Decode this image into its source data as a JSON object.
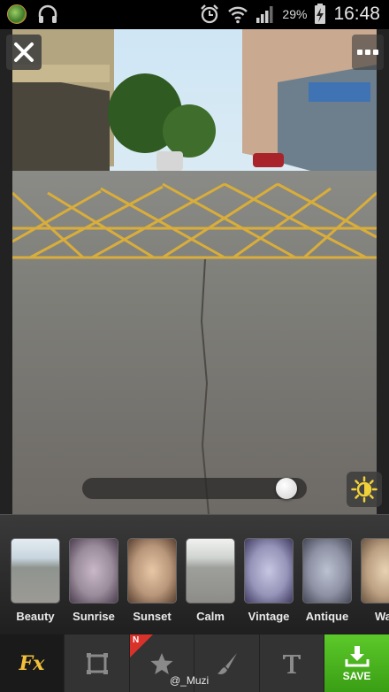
{
  "status_bar": {
    "battery_percent": "29%",
    "time": "16:48",
    "icons": [
      "globe-app-icon",
      "headphones-icon",
      "alarm-icon",
      "wifi-icon",
      "signal-icon",
      "battery-charging-icon"
    ]
  },
  "editor": {
    "close_icon": "close-icon",
    "more_icon": "more-icon",
    "brightness_icon": "brightness-icon",
    "intensity_level": 0.95
  },
  "filters": [
    {
      "label": "Beauty"
    },
    {
      "label": "Sunrise"
    },
    {
      "label": "Sunset"
    },
    {
      "label": "Calm"
    },
    {
      "label": "Vintage"
    },
    {
      "label": "Antique"
    },
    {
      "label": "War"
    }
  ],
  "toolbar": {
    "fx_label": "Fx",
    "new_badge": "N",
    "save_label": "SAVE",
    "watermark": "@_Muzi",
    "tools": [
      "fx-tool",
      "crop-tool",
      "sticker-tool",
      "brush-tool",
      "text-tool",
      "save-tool"
    ]
  },
  "colors": {
    "accent_yellow": "#f2c13b",
    "save_green": "#4cb81f",
    "badge_red": "#d8322b"
  }
}
